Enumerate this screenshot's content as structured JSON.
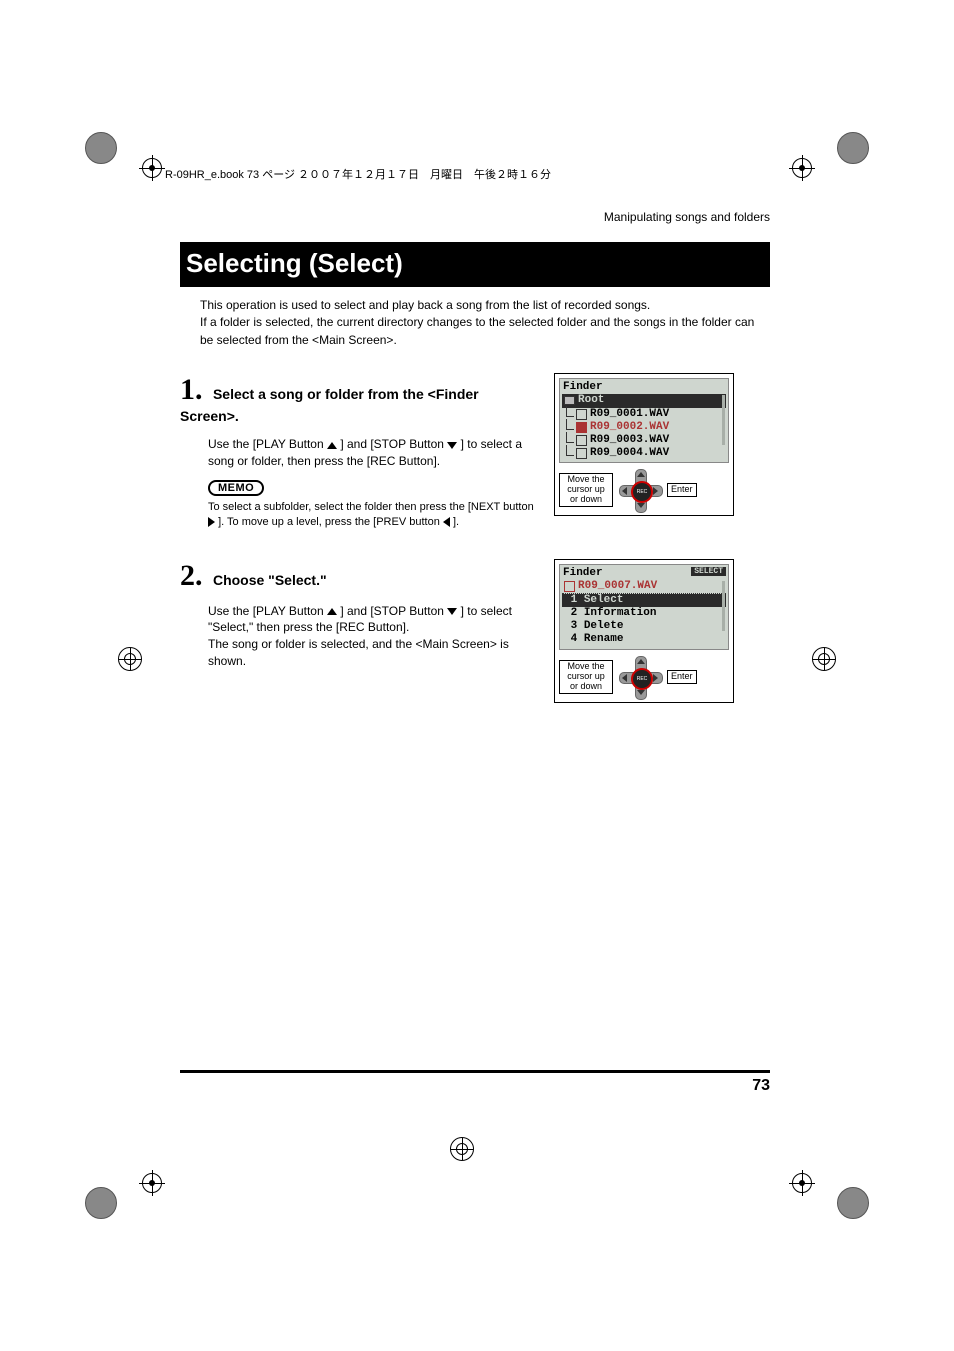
{
  "header": {
    "book_line": "R-09HR_e.book  73 ページ  ２００７年１２月１７日　月曜日　午後２時１６分"
  },
  "chapter_label": "Manipulating songs and folders",
  "section_title": "Selecting (Select)",
  "intro": [
    "This operation is used to select and play back a song from the list of recorded songs.",
    "If a folder is selected, the current directory changes to the selected folder and the songs in the folder can be selected from the <Main Screen>."
  ],
  "steps": [
    {
      "number": "1.",
      "heading": "Select a song or folder from the <Finder Screen>.",
      "body_before_play": "Use the [PLAY Button ",
      "body_mid": " ] and [STOP Button ",
      "body_after_stop": " ] to select a song or folder, then press the [REC Button].",
      "memo_label": "MEMO",
      "memo_before_next": "To select a subfolder, select the folder then press the [NEXT button ",
      "memo_mid": " ]. To move up a level, press the [PREV button ",
      "memo_end": " ].",
      "lcd": {
        "title": "Finder",
        "root": "Root",
        "items": [
          {
            "name": "R09_0001.WAV",
            "selected": false
          },
          {
            "name": "R09_0002.WAV",
            "selected": true
          },
          {
            "name": "R09_0003.WAV",
            "selected": false
          },
          {
            "name": "R09_0004.WAV",
            "selected": false
          }
        ],
        "move_label": "Move the cursor up or down",
        "enter_label": "Enter",
        "rec_label": "REC"
      }
    },
    {
      "number": "2.",
      "heading": "Choose \"Select.\"",
      "body_before_play": "Use the [PLAY Button ",
      "body_mid": " ] and [STOP Button ",
      "body_after_stop": " ] to select \"Select,\" then press the [REC Button].",
      "body_extra": "The song or folder is selected, and the <Main Screen> is shown.",
      "lcd": {
        "title": "Finder",
        "badge": "SELECT",
        "file": "R09_0007.WAV",
        "menu": [
          {
            "n": "1",
            "label": "Select",
            "selected": true
          },
          {
            "n": "2",
            "label": "Information",
            "selected": false
          },
          {
            "n": "3",
            "label": "Delete",
            "selected": false
          },
          {
            "n": "4",
            "label": "Rename",
            "selected": false
          }
        ],
        "move_label": "Move the cursor up or down",
        "enter_label": "Enter",
        "rec_label": "REC"
      }
    }
  ],
  "page_number": "73"
}
